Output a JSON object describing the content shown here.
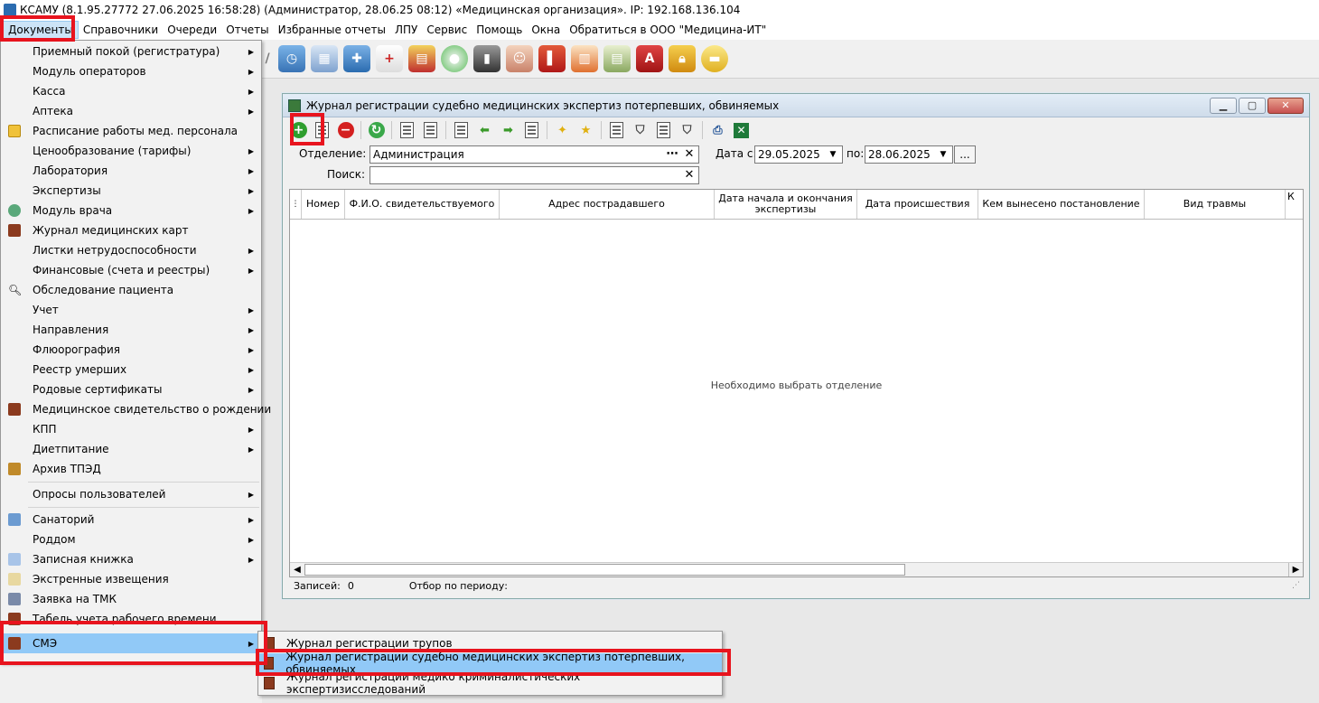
{
  "titlebar": {
    "text": "КСАМУ (8.1.95.27772 27.06.2025 16:58:28) (Администратор, 28.06.25 08:12)  «Медицинская организация». IP: 192.168.136.104"
  },
  "menubar": {
    "items": [
      "Документы",
      "Справочники",
      "Очереди",
      "Отчеты",
      "Избранные отчеты",
      "ЛПУ",
      "Сервис",
      "Помощь",
      "Окна",
      "Обратиться в ООО \"Медицина-ИТ\""
    ]
  },
  "documents_menu": {
    "items": [
      {
        "label": "Приемный покой (регистратура)",
        "has_submenu": true,
        "icon": "none"
      },
      {
        "label": "Модуль операторов",
        "has_submenu": true,
        "icon": "none"
      },
      {
        "label": "Касса",
        "has_submenu": true,
        "icon": "none"
      },
      {
        "label": "Аптека",
        "has_submenu": true,
        "icon": "none"
      },
      {
        "label": "Расписание работы мед. персонала",
        "has_submenu": false,
        "icon": "schedule-icon"
      },
      {
        "label": "Ценообразование (тарифы)",
        "has_submenu": true,
        "icon": "none"
      },
      {
        "label": "Лаборатория",
        "has_submenu": true,
        "icon": "none"
      },
      {
        "label": "Экспертизы",
        "has_submenu": true,
        "icon": "none"
      },
      {
        "label": "Модуль врача",
        "has_submenu": true,
        "icon": "doctor-icon"
      },
      {
        "label": "Журнал медицинских карт",
        "has_submenu": false,
        "icon": "book-icon"
      },
      {
        "label": "Листки нетрудоспособности",
        "has_submenu": true,
        "icon": "none"
      },
      {
        "label": "Финансовые (счета и реестры)",
        "has_submenu": true,
        "icon": "none"
      },
      {
        "label": "Обследование пациента",
        "has_submenu": false,
        "icon": "search-icon"
      },
      {
        "label": "Учет",
        "has_submenu": true,
        "icon": "none"
      },
      {
        "label": "Направления",
        "has_submenu": true,
        "icon": "none"
      },
      {
        "label": "Флюорография",
        "has_submenu": true,
        "icon": "none"
      },
      {
        "label": "Реестр умерших",
        "has_submenu": true,
        "icon": "none"
      },
      {
        "label": "Родовые сертификаты",
        "has_submenu": true,
        "icon": "none"
      },
      {
        "label": "Медицинское свидетельство о рождении",
        "has_submenu": false,
        "icon": "book-icon"
      },
      {
        "label": "КПП",
        "has_submenu": true,
        "icon": "none"
      },
      {
        "label": "Диетпитание",
        "has_submenu": true,
        "icon": "none"
      },
      {
        "label": "Архив ТПЭД",
        "has_submenu": false,
        "icon": "archive-icon"
      }
    ],
    "items2": [
      {
        "label": "Опросы пользователей",
        "has_submenu": true,
        "icon": "none"
      }
    ],
    "items3": [
      {
        "label": "Санаторий",
        "has_submenu": true,
        "icon": "house-icon"
      },
      {
        "label": "Роддом",
        "has_submenu": true,
        "icon": "none"
      },
      {
        "label": "Записная книжка",
        "has_submenu": true,
        "icon": "notebook-icon"
      },
      {
        "label": "Экстренные извещения",
        "has_submenu": false,
        "icon": "notice-icon"
      },
      {
        "label": "Заявка на ТМК",
        "has_submenu": false,
        "icon": "people-icon"
      },
      {
        "label": "Табель учета рабочего времени",
        "has_submenu": false,
        "icon": "book-icon"
      },
      {
        "label": "СМЭ",
        "has_submenu": true,
        "icon": "book-icon",
        "highlighted": true
      }
    ]
  },
  "sme_submenu": {
    "items": [
      {
        "label": "Журнал регистрации трупов",
        "highlighted": false
      },
      {
        "label": "Журнал регистрации судебно медицинских экспертиз потерпевших, обвиняемых",
        "highlighted": true
      },
      {
        "label": "Журнал регистрации медико криминалистических экспертизисследований",
        "highlighted": false
      }
    ]
  },
  "journal_window": {
    "title": "Журнал регистрации судебно медицинских экспертиз потерпевших, обвиняемых",
    "filters": {
      "department_label": "Отделение:",
      "department_value": "Администрация",
      "date_from_label": "Дата с:",
      "date_from_value": "29.05.2025",
      "date_to_label": "по:",
      "date_to_value": "28.06.2025",
      "search_label": "Поиск:",
      "search_value": ""
    },
    "grid": {
      "columns": [
        "Номер",
        "Ф.И.О. свидетельствуемого",
        "Адрес пострадавшего",
        "Дата начала и окончания экспертизы",
        "Дата происшествия",
        "Кем вынесено постановление",
        "Вид травмы",
        "К"
      ],
      "empty_text": "Необходимо выбрать отделение"
    },
    "status": {
      "records_label": "Записей:",
      "records_value": "0",
      "period_label": "Отбор по периоду:"
    }
  },
  "colors": {
    "highlight": "#91c9f7",
    "callout_red": "#e8141e",
    "add_green": "#2e9e2e"
  }
}
